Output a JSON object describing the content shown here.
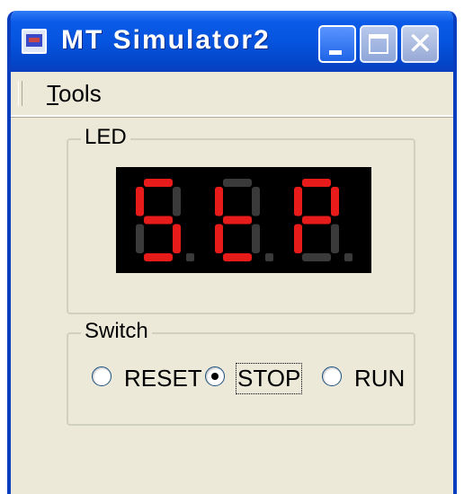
{
  "window": {
    "title": "MT Simulator2",
    "icon": "app-icon",
    "buttons": [
      "minimize",
      "maximize",
      "close"
    ]
  },
  "menu": {
    "tools_underline": "T",
    "tools_rest": "ools"
  },
  "led_group": {
    "legend": "LED",
    "digit_color_on": "#e81b1b",
    "digit_color_off": "#3a3a3a",
    "digits": [
      {
        "char": "S",
        "decimal_point": false
      },
      {
        "char": "t",
        "decimal_point": false
      },
      {
        "char": "P",
        "decimal_point": false
      }
    ]
  },
  "switch_group": {
    "legend": "Switch",
    "options": [
      {
        "label": "RESET",
        "selected": false
      },
      {
        "label": "STOP",
        "selected": true
      },
      {
        "label": "RUN",
        "selected": false
      }
    ]
  },
  "colors": {
    "titlebar": "#0654df",
    "window_bg": "#ece9d8"
  }
}
